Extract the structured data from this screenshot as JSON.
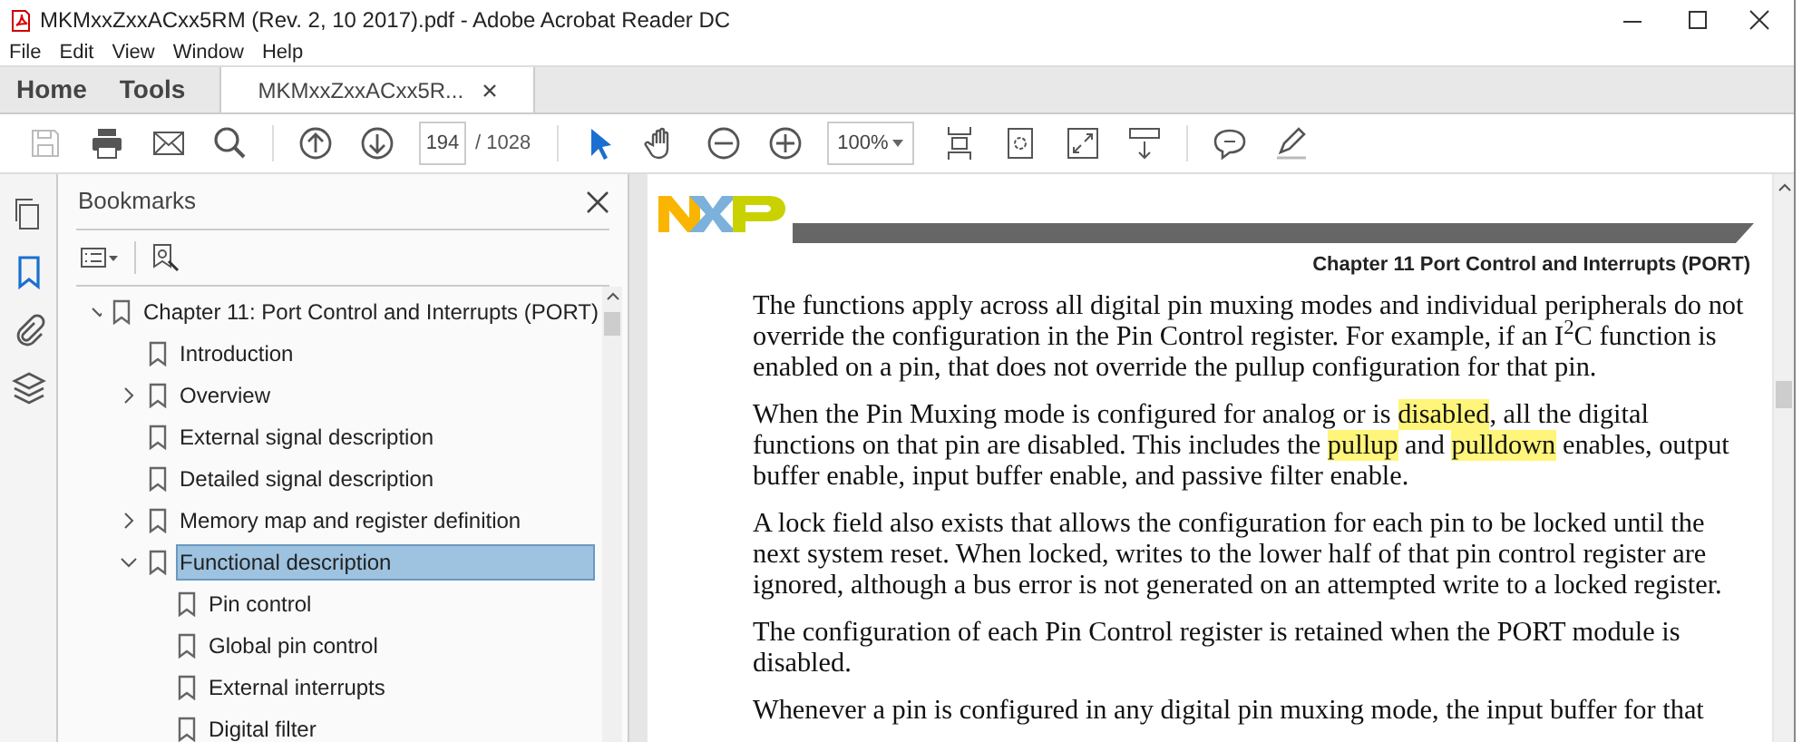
{
  "window": {
    "title": "MKMxxZxxACxx5RM (Rev. 2, 10 2017).pdf - Adobe Acrobat Reader DC"
  },
  "menu": [
    "File",
    "Edit",
    "View",
    "Window",
    "Help"
  ],
  "tabs": [
    {
      "label": "Home",
      "selected": false,
      "kind": "nav"
    },
    {
      "label": "Tools",
      "selected": false,
      "kind": "nav"
    },
    {
      "label": "MKMxxZxxACxx5R...",
      "selected": true,
      "kind": "document"
    }
  ],
  "toolbar": {
    "page": "194",
    "page_total": "/ 1028",
    "zoom": "100%"
  },
  "side_rail": [
    {
      "kind": "pages",
      "selected": false
    },
    {
      "kind": "bookmarks",
      "selected": true
    },
    {
      "kind": "attachments",
      "selected": false
    },
    {
      "kind": "layers",
      "selected": false
    }
  ],
  "bookmarks": {
    "title": "Bookmarks",
    "tree": [
      {
        "label": "Chapter 11: Port Control and Interrupts (PORT)",
        "expanded": true,
        "selected": false,
        "children": [
          {
            "label": "Introduction",
            "selected": false
          },
          {
            "label": "Overview",
            "expanded": false,
            "selected": false
          },
          {
            "label": "External signal description",
            "selected": false
          },
          {
            "label": "Detailed signal description",
            "selected": false
          },
          {
            "label": "Memory map and register definition",
            "expanded": false,
            "selected": false
          },
          {
            "label": "Functional description",
            "expanded": true,
            "selected": true,
            "children": [
              {
                "label": "Pin control",
                "selected": false
              },
              {
                "label": "Global pin control",
                "selected": false
              },
              {
                "label": "External interrupts",
                "selected": false
              },
              {
                "label": "Digital filter",
                "selected": false
              }
            ]
          }
        ]
      }
    ]
  },
  "document": {
    "header": "Chapter 11 Port Control and Interrupts (PORT)",
    "paragraphs": [
      [
        {
          "text": "The functions apply across all digital pin muxing modes and individual peripherals do not override the configuration in the Pin Control register. For example, if an I$^{2}$C function is enabled on a pin, that does not override the pullup configuration for that pin.",
          "highlighted": false
        }
      ],
      [
        {
          "text": "When the Pin Muxing mode is configured for analog or is ",
          "highlighted": false
        },
        {
          "text": "disabled",
          "highlighted": true
        },
        {
          "text": ", all the digital functions on that pin are disabled. This includes the ",
          "highlighted": false
        },
        {
          "text": "pullup",
          "highlighted": true
        },
        {
          "text": " and ",
          "highlighted": false
        },
        {
          "text": "pulldown",
          "highlighted": true
        },
        {
          "text": " enables, output buffer enable, input buffer enable, and passive filter enable.",
          "highlighted": false
        }
      ],
      [
        {
          "text": "A lock field also exists that allows the configuration for each pin to be locked until the next system reset. When locked, writes to the lower half of that pin control register are ignored, although a bus error is not generated on an attempted write to a locked register.",
          "highlighted": false
        }
      ],
      [
        {
          "text": "The configuration of each Pin Control register is retained when the PORT module is disabled.",
          "highlighted": false
        }
      ],
      [
        {
          "text": "Whenever a pin is configured in any digital pin muxing mode, the input buffer for that",
          "highlighted": false
        }
      ]
    ]
  }
}
